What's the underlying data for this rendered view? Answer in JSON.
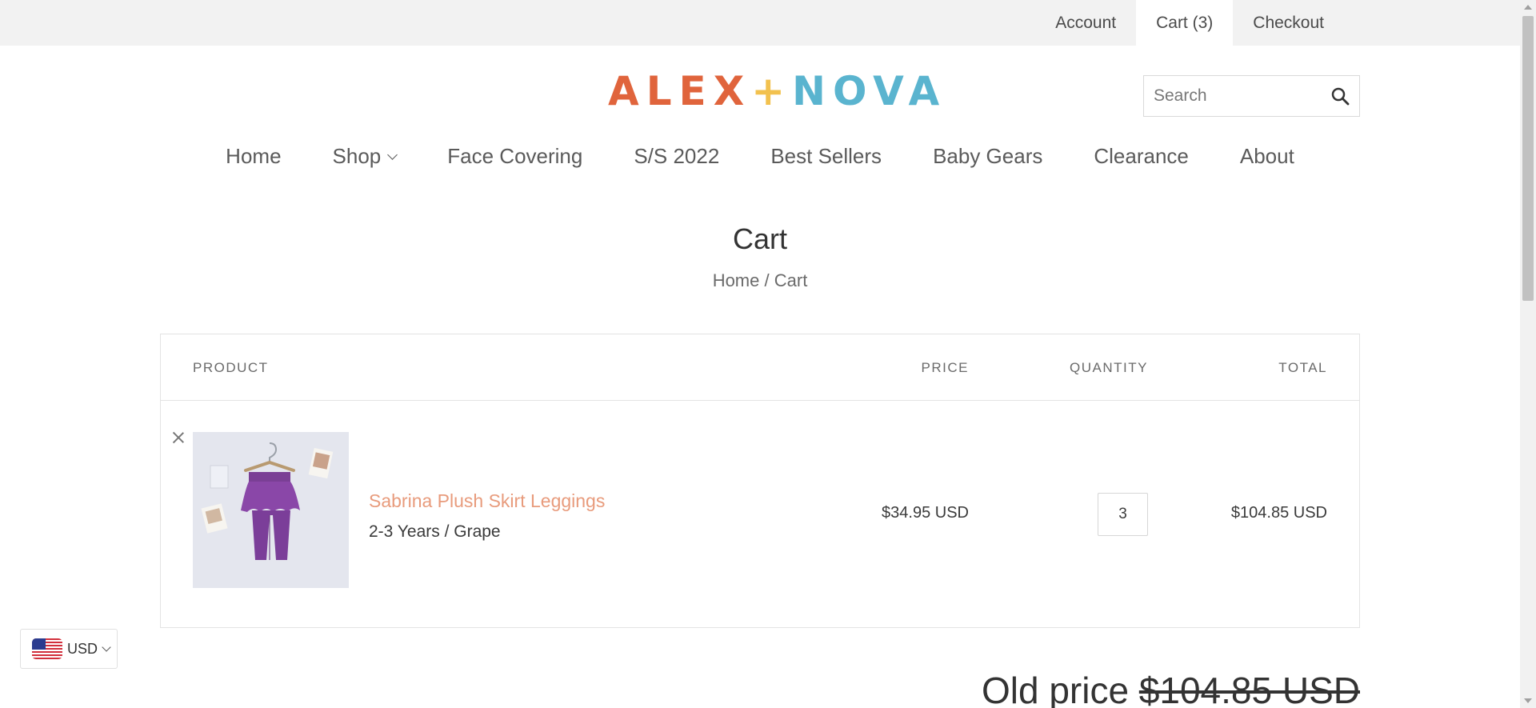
{
  "topbar": {
    "account_label": "Account",
    "cart_label": "Cart (3)",
    "checkout_label": "Checkout"
  },
  "logo": {
    "part1": "ALEX",
    "plus": "+",
    "part2": "NOVA"
  },
  "search": {
    "placeholder": "Search",
    "icon": "search-icon"
  },
  "nav": {
    "items": [
      {
        "label": "Home"
      },
      {
        "label": "Shop",
        "has_dropdown": true
      },
      {
        "label": "Face Covering"
      },
      {
        "label": "S/S 2022"
      },
      {
        "label": "Best Sellers"
      },
      {
        "label": "Baby Gears"
      },
      {
        "label": "Clearance"
      },
      {
        "label": "About"
      }
    ]
  },
  "page": {
    "title": "Cart",
    "breadcrumb": {
      "home": "Home",
      "separator": "/",
      "current": "Cart"
    }
  },
  "cart": {
    "headers": {
      "product": "PRODUCT",
      "price": "PRICE",
      "quantity": "QUANTITY",
      "total": "TOTAL"
    },
    "items": [
      {
        "name": "Sabrina Plush Skirt Leggings",
        "variant": "2-3 Years / Grape",
        "price": "$34.95 USD",
        "quantity": "3",
        "total": "$104.85 USD"
      }
    ]
  },
  "currency": {
    "code": "USD",
    "flag": "us-flag-icon"
  },
  "summary": {
    "old_price_label": "Old price",
    "old_price_value": "$104.85 USD"
  },
  "colors": {
    "logo_orange": "#e0643c",
    "logo_yellow": "#f2c14e",
    "logo_blue": "#5ab4cf",
    "product_link": "#e89b7c",
    "topbar_bg": "#f2f2f2"
  }
}
